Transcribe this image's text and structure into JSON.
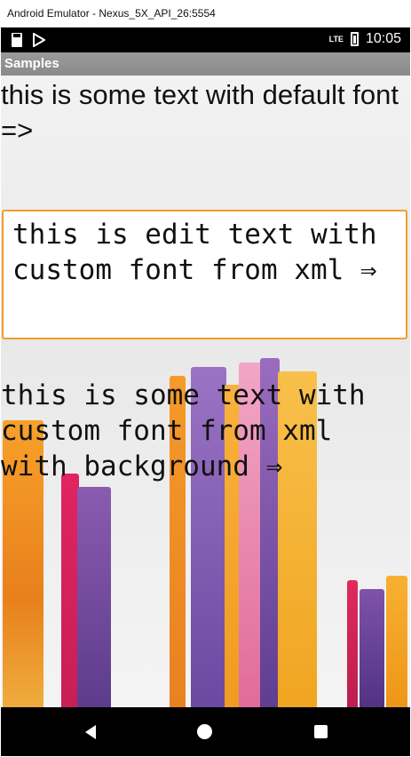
{
  "window": {
    "title": "Android Emulator - Nexus_5X_API_26:5554"
  },
  "status_bar": {
    "left_icons": [
      "sd-card-icon",
      "play-store-icon"
    ],
    "network_label": "LTE",
    "time": "10:05"
  },
  "toolbar": {
    "title": "Samples"
  },
  "content": {
    "default_text": "this is some text with default font =>",
    "edit_text": "this is edit text with custom font from xml ⇒",
    "background_text": "this is some text with custom font from xml with background ⇒"
  },
  "nav_bar": {
    "icons": [
      "back-icon",
      "home-icon",
      "recents-icon"
    ]
  },
  "colors": {
    "edit_border": "#f29c2c",
    "status_bar": "#000000",
    "toolbar": "#8f8f8f",
    "nav_bar": "#000000"
  }
}
